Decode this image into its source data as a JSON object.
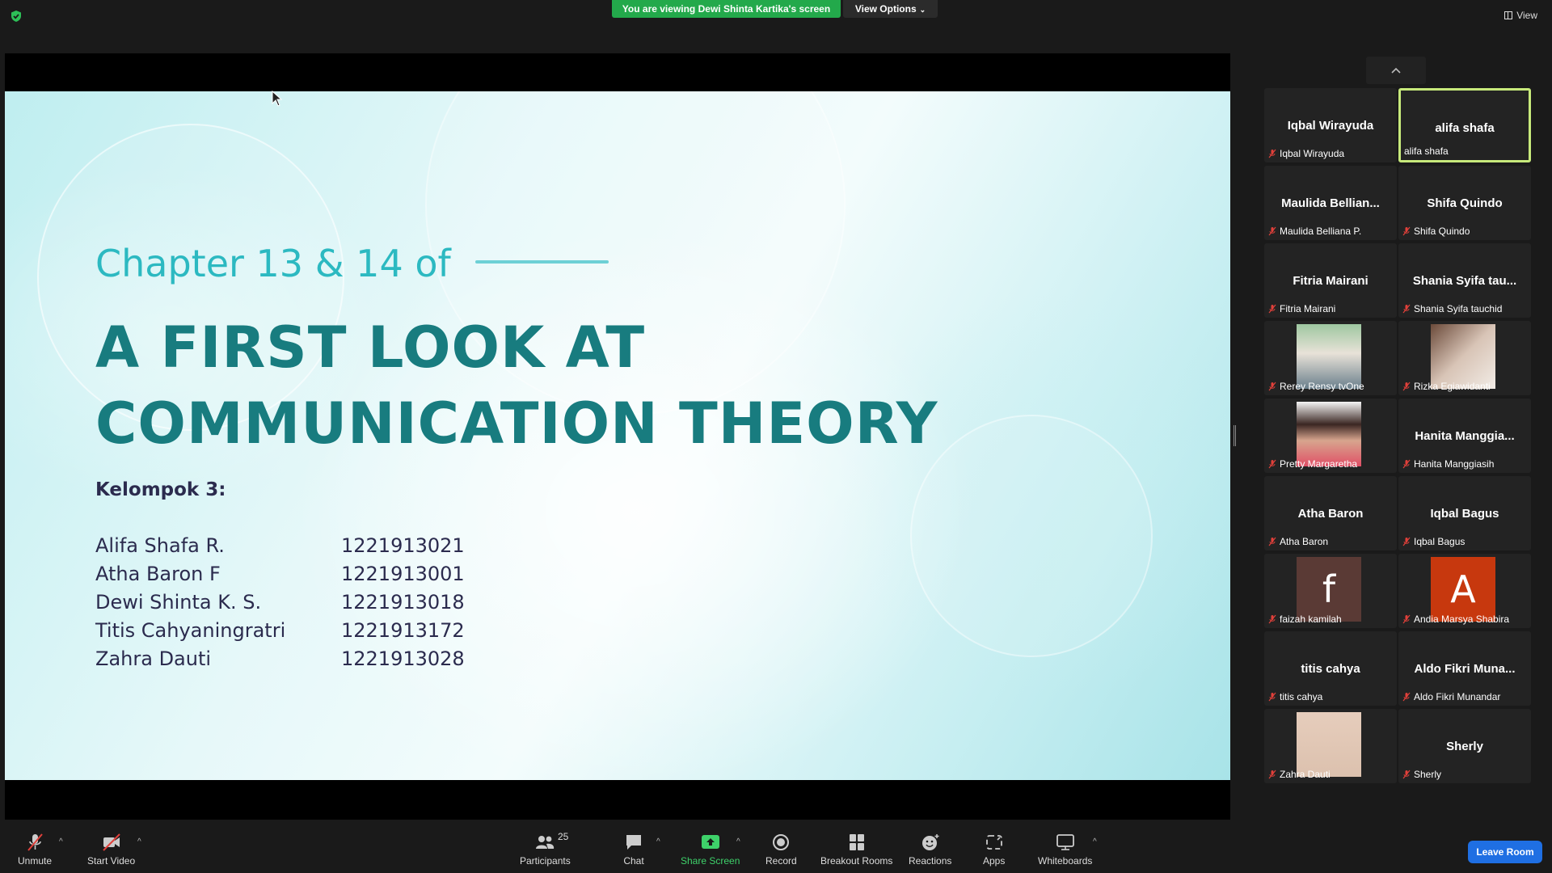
{
  "topbar": {
    "banner": "You are viewing Dewi Shinta Kartika's screen",
    "view_options": "View Options",
    "view": "View"
  },
  "slide": {
    "chapter": "Chapter 13 & 14 of",
    "title_line1": "A FIRST LOOK AT",
    "title_line2": "COMMUNICATION THEORY",
    "group_label": "Kelompok 3:",
    "members": [
      {
        "name": "Alifa Shafa R.",
        "id": "1221913021"
      },
      {
        "name": "Atha Baron F",
        "id": "1221913001"
      },
      {
        "name": "Dewi Shinta K. S.",
        "id": "1221913018"
      },
      {
        "name": "Titis Cahyaningratri",
        "id": "1221913172"
      },
      {
        "name": "Zahra Dauti",
        "id": "1221913028"
      }
    ]
  },
  "participants": [
    {
      "big": "Iqbal Wirayuda",
      "label": "Iqbal Wirayuda"
    },
    {
      "big": "alifa shafa",
      "label": "alifa shafa",
      "active": true
    },
    {
      "big": "Maulida  Bellian...",
      "label": "Maulida Belliana P."
    },
    {
      "big": "Shifa Quindo",
      "label": "Shifa Quindo"
    },
    {
      "big": "Fitria Mairani",
      "label": "Fitria Mairani"
    },
    {
      "big": "Shania  Syifa  tau...",
      "label": "Shania Syifa tauchid"
    },
    {
      "big": "",
      "label": "Rerey Rensy tvOne",
      "photo": "photo-hijab"
    },
    {
      "big": "",
      "label": "Rizka Egiawidanti",
      "photo": "photo-lying"
    },
    {
      "big": "",
      "label": "Pretty Margaretha",
      "photo": "photo-portrait"
    },
    {
      "big": "Hanita  Manggia...",
      "label": "Hanita Manggiasih"
    },
    {
      "big": "Atha Baron",
      "label": "Atha Baron"
    },
    {
      "big": "Iqbal Bagus",
      "label": "Iqbal Bagus"
    },
    {
      "big": "",
      "label": "faizah kamilah",
      "letter": "f",
      "letter_bg": "#5a3a35"
    },
    {
      "big": "",
      "label": "Andia Marsya Shabira",
      "letter": "A",
      "letter_bg": "#c7380e"
    },
    {
      "big": "titis cahya",
      "label": "titis cahya"
    },
    {
      "big": "Aldo  Fikri  Muna...",
      "label": "Aldo Fikri Munandar"
    },
    {
      "big": "",
      "label": "Zahra Dauti",
      "photo": "photo-beige"
    },
    {
      "big": "Sherly",
      "label": "Sherly"
    }
  ],
  "toolbar": {
    "unmute": "Unmute",
    "start_video": "Start Video",
    "participants": "Participants",
    "participants_count": "25",
    "chat": "Chat",
    "share_screen": "Share Screen",
    "record": "Record",
    "breakout_rooms": "Breakout Rooms",
    "reactions": "Reactions",
    "apps": "Apps",
    "whiteboards": "Whiteboards",
    "leave_room": "Leave Room"
  },
  "colors": {
    "banner_green": "#23a94b",
    "active_tile_border": "#c7e97b",
    "leave_blue": "#1f6fe3",
    "slide_teal": "#187c7f",
    "chapter_teal": "#2cb9c1"
  }
}
